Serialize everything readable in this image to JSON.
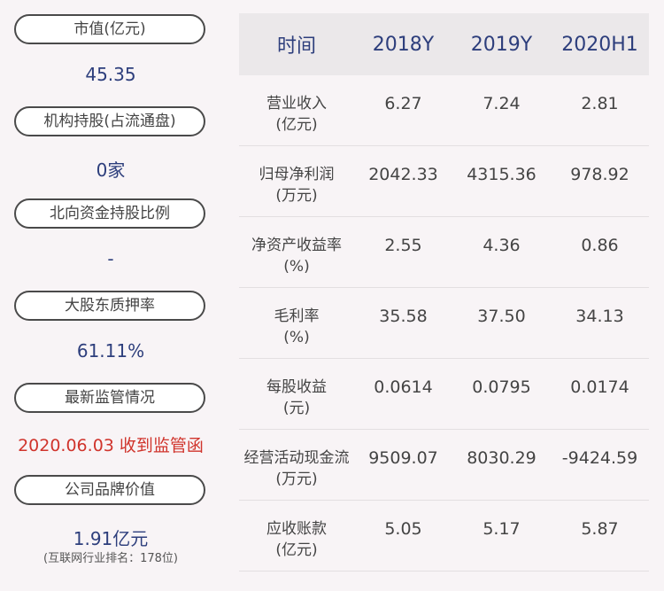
{
  "left": {
    "items": [
      {
        "label": "市值(亿元)",
        "value": "45.35"
      },
      {
        "label": "机构持股(占流通盘)",
        "value": "0家"
      },
      {
        "label": "北向资金持股比例",
        "value": "-"
      },
      {
        "label": "大股东质押率",
        "value": "61.11%"
      },
      {
        "label": "最新监管情况",
        "value": "2020.06.03 收到监管函"
      },
      {
        "label": "公司品牌价值",
        "value": "1.91亿元",
        "note": "(互联网行业排名：178位)"
      }
    ]
  },
  "table": {
    "headers": [
      "时间",
      "2018Y",
      "2019Y",
      "2020H1"
    ],
    "rows": [
      {
        "label_line1": "营业收入",
        "label_line2": "(亿元)",
        "values": [
          "6.27",
          "7.24",
          "2.81"
        ]
      },
      {
        "label_line1": "归母净利润",
        "label_line2": "(万元)",
        "values": [
          "2042.33",
          "4315.36",
          "978.92"
        ]
      },
      {
        "label_line1": "净资产收益率",
        "label_line2": "(%)",
        "values": [
          "2.55",
          "4.36",
          "0.86"
        ]
      },
      {
        "label_line1": "毛利率",
        "label_line2": "(%)",
        "values": [
          "35.58",
          "37.50",
          "34.13"
        ]
      },
      {
        "label_line1": "每股收益",
        "label_line2": "(元)",
        "values": [
          "0.0614",
          "0.0795",
          "0.0174"
        ]
      },
      {
        "label_line1": "经营活动现金流",
        "label_line2": "(万元)",
        "values": [
          "9509.07",
          "8030.29",
          "-9424.59"
        ]
      },
      {
        "label_line1": "应收账款",
        "label_line2": "(亿元)",
        "values": [
          "5.05",
          "5.17",
          "5.87"
        ]
      }
    ]
  },
  "colors": {
    "accent": "#2d3e7c",
    "alert": "#d0342c"
  }
}
